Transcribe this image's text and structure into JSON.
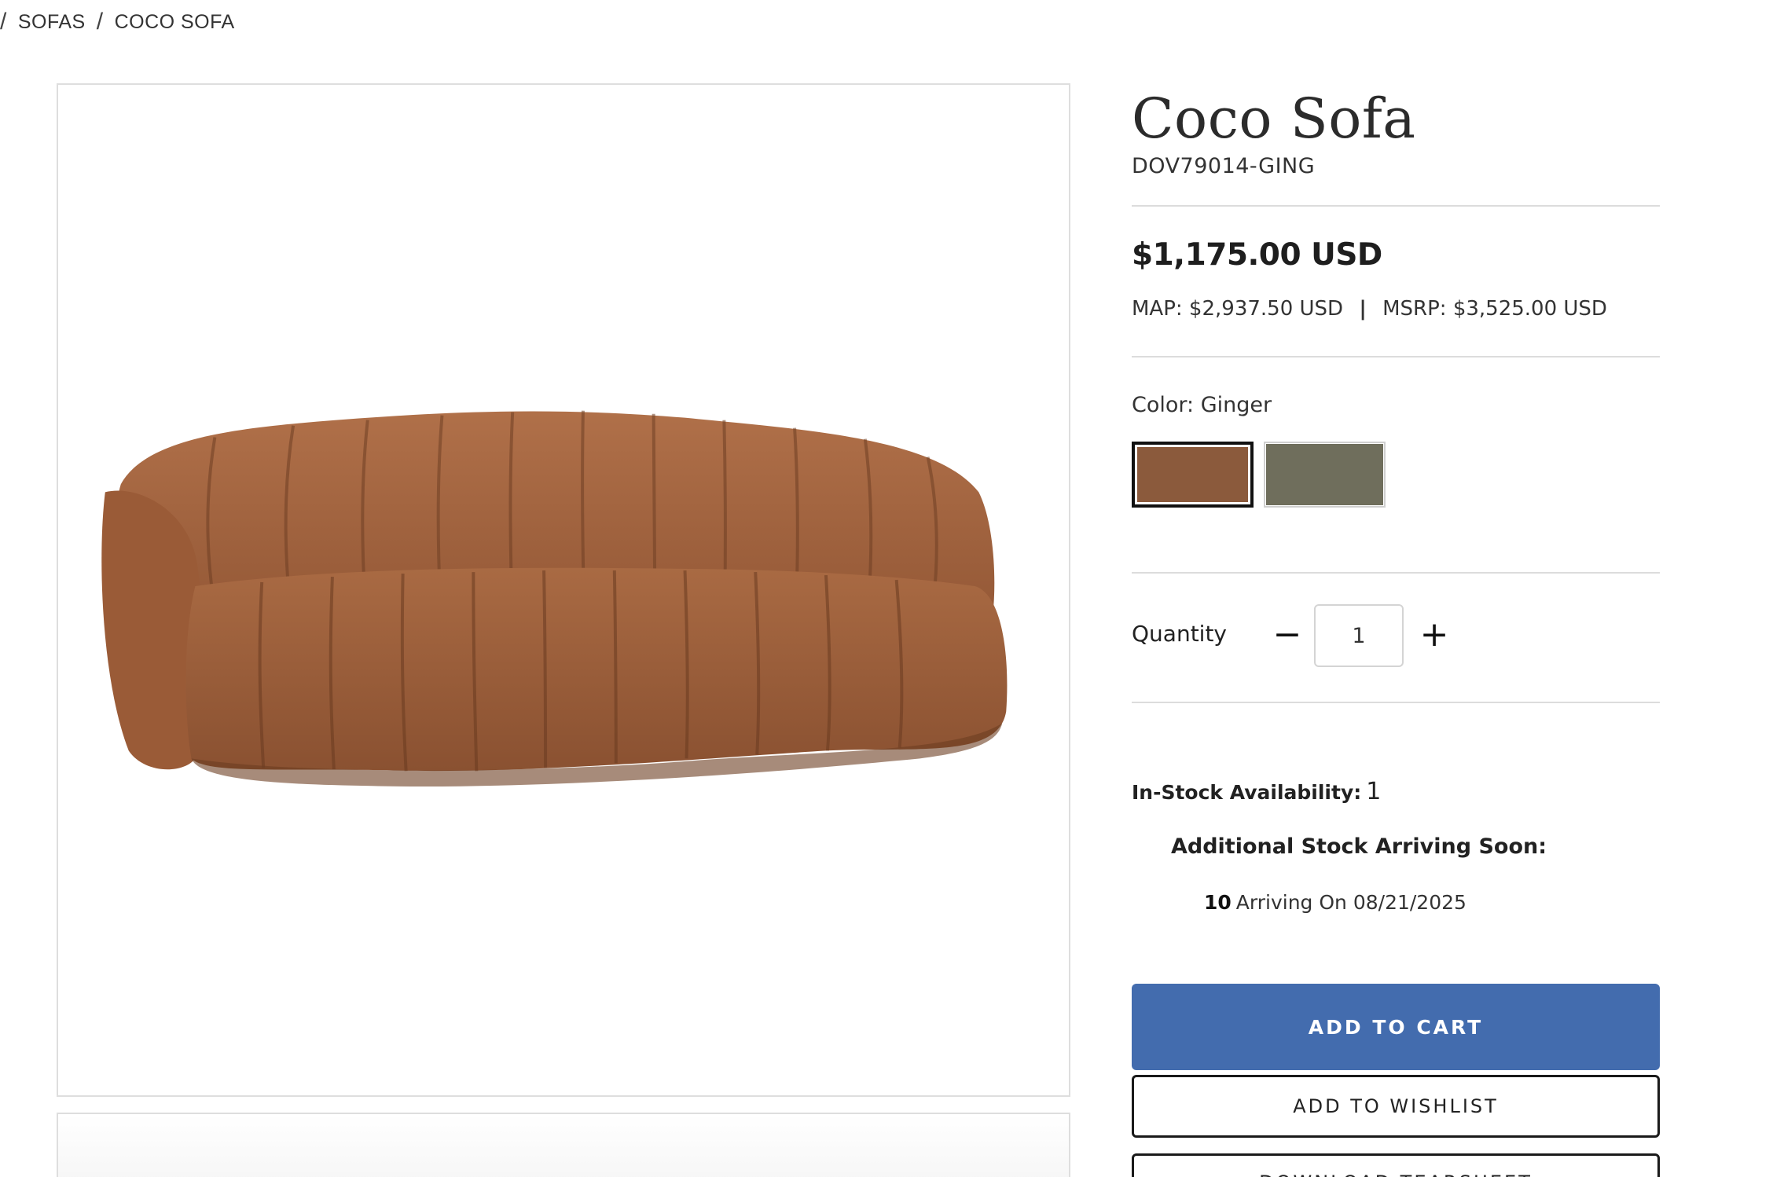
{
  "breadcrumb": {
    "items": [
      "SOFAS",
      "COCO SOFA"
    ]
  },
  "product": {
    "title": "Coco Sofa",
    "sku": "DOV79014-GING",
    "price": "$1,175.00 USD",
    "map": "MAP: $2,937.50 USD",
    "msrp": "MSRP: $3,525.00 USD",
    "pipe": "|"
  },
  "color": {
    "label": "Color: Ginger",
    "swatches": [
      {
        "name": "Ginger",
        "hex": "#8b5a3c",
        "selected": true
      },
      {
        "name": "Olive",
        "hex": "#6f6e5c",
        "selected": false
      }
    ]
  },
  "quantity": {
    "label": "Quantity",
    "minus": "−",
    "value": "1",
    "plus": "+"
  },
  "stock": {
    "label": "In-Stock Availability:",
    "value": "1",
    "arriving_heading": "Additional Stock Arriving Soon:",
    "arriving_qty": "10",
    "arriving_text": "Arriving On 08/21/2025"
  },
  "actions": {
    "add_to_cart": "ADD TO CART",
    "add_to_wishlist": "ADD TO WISHLIST",
    "download_tearsheet": "DOWNLOAD TEARSHEET"
  },
  "colors": {
    "cart_button": "#436cae",
    "sofa_fabric": "#a3653e"
  }
}
